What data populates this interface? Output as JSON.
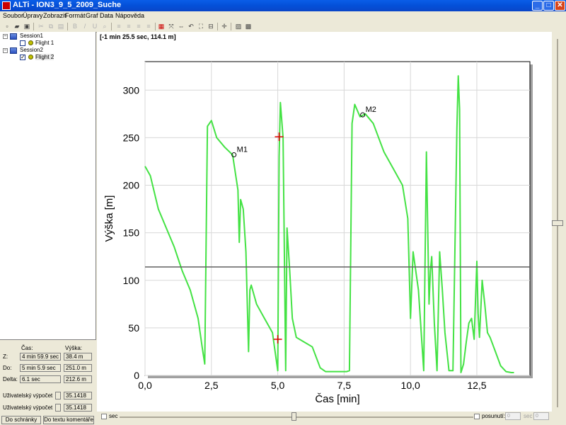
{
  "window": {
    "title": "ALTi - ION3_9_5_2009_Suche"
  },
  "menu": [
    "Soubor",
    "Úpravy",
    "Zobrazit",
    "Formát",
    "Graf",
    "Data",
    "Nápověda"
  ],
  "tree": {
    "sessions": [
      {
        "label": "Session1",
        "flights": [
          {
            "label": "Flight 1",
            "checked": false
          }
        ]
      },
      {
        "label": "Session2",
        "flights": [
          {
            "label": "Flight 2",
            "checked": true
          }
        ]
      }
    ]
  },
  "info": {
    "col_time": "Čas:",
    "col_height": "Výška:",
    "rows": [
      {
        "label": "Z:",
        "time": "4 min 59.9 sec",
        "height": "38.4 m"
      },
      {
        "label": "Do:",
        "time": "5 min 5.9 sec",
        "height": "251.0 m"
      },
      {
        "label": "Delta:",
        "time": "6.1 sec",
        "height": "212.6 m"
      }
    ],
    "calc1_label": "Uživatelský výpočet",
    "calc1_value": "35.1418",
    "calc2_label": "Uživatelský výpočet",
    "calc2_value": "35.1418",
    "btn_clipboard": "Do schránky",
    "btn_comment": "Do textu komentáře"
  },
  "cursor_readout": "[-1 min 25.5 sec, 114.1 m]",
  "bottom": {
    "sec_label": "sec",
    "posunuti_label": "posunutí:",
    "field1": "0",
    "unit1": "sec",
    "field2": "0"
  },
  "chart_data": {
    "type": "line",
    "xlabel": "Čas [min]",
    "ylabel": "Výška [m]",
    "xlim": [
      0,
      14.5
    ],
    "ylim": [
      0,
      330
    ],
    "xticks": [
      0,
      2.5,
      5,
      7.5,
      10,
      12.5
    ],
    "xtick_labels": [
      "0,0",
      "2,5",
      "5,0",
      "7,5",
      "10,0",
      "12,5"
    ],
    "yticks": [
      0,
      50,
      100,
      150,
      200,
      250,
      300
    ],
    "ytick_labels": [
      "0",
      "50",
      "100",
      "150",
      "200",
      "250",
      "300"
    ],
    "grid": true,
    "series_color": "#44e244",
    "series": [
      {
        "x": [
          0,
          0.2,
          0.5,
          0.8,
          1.1,
          1.4,
          1.7,
          2.0,
          2.15,
          2.25,
          2.35,
          2.5,
          2.7,
          3.0,
          3.3,
          3.5,
          3.55,
          3.6,
          3.7,
          3.8,
          3.9,
          3.95,
          4.0,
          4.2,
          4.5,
          4.8,
          5.0,
          5.05,
          5.1,
          5.2,
          5.3,
          5.35,
          5.45,
          5.55,
          5.7,
          6.0,
          6.3,
          6.6,
          6.8,
          7.0,
          7.3,
          7.6,
          7.7,
          7.8,
          7.9,
          8.1,
          8.3,
          8.6,
          9.0,
          9.4,
          9.7,
          9.9,
          10.0,
          10.1,
          10.3,
          10.5,
          10.6,
          10.7,
          10.75,
          10.8,
          10.9,
          11.0,
          11.1,
          11.2,
          11.3,
          11.45,
          11.6,
          11.75,
          11.8,
          11.85,
          11.9,
          12.0,
          12.1,
          12.2,
          12.3,
          12.4,
          12.5,
          12.55,
          12.6,
          12.7,
          12.8,
          12.9,
          13.0,
          13.2,
          13.4,
          13.6,
          13.8,
          13.9
        ],
        "y": [
          220,
          210,
          175,
          155,
          135,
          110,
          90,
          60,
          30,
          12,
          262,
          268,
          250,
          240,
          232,
          195,
          140,
          185,
          175,
          130,
          25,
          90,
          95,
          75,
          60,
          45,
          5,
          230,
          287,
          250,
          5,
          155,
          110,
          60,
          40,
          35,
          30,
          8,
          4,
          4,
          4,
          4,
          5,
          265,
          285,
          272,
          275,
          265,
          235,
          215,
          200,
          165,
          60,
          130,
          90,
          5,
          235,
          75,
          110,
          125,
          55,
          5,
          130,
          90,
          45,
          5,
          5,
          260,
          315,
          280,
          3,
          12,
          35,
          55,
          60,
          38,
          120,
          65,
          40,
          100,
          75,
          45,
          40,
          25,
          10,
          4,
          3,
          3
        ]
      }
    ],
    "markers": [
      {
        "label": "M1",
        "x": 3.35,
        "y": 232
      },
      {
        "label": "M2",
        "x": 8.2,
        "y": 274
      }
    ],
    "cursor_crosses": [
      {
        "x": 5.05,
        "y": 251
      },
      {
        "x": 5.0,
        "y": 38
      }
    ],
    "horizontal_line_y": 114.1
  }
}
